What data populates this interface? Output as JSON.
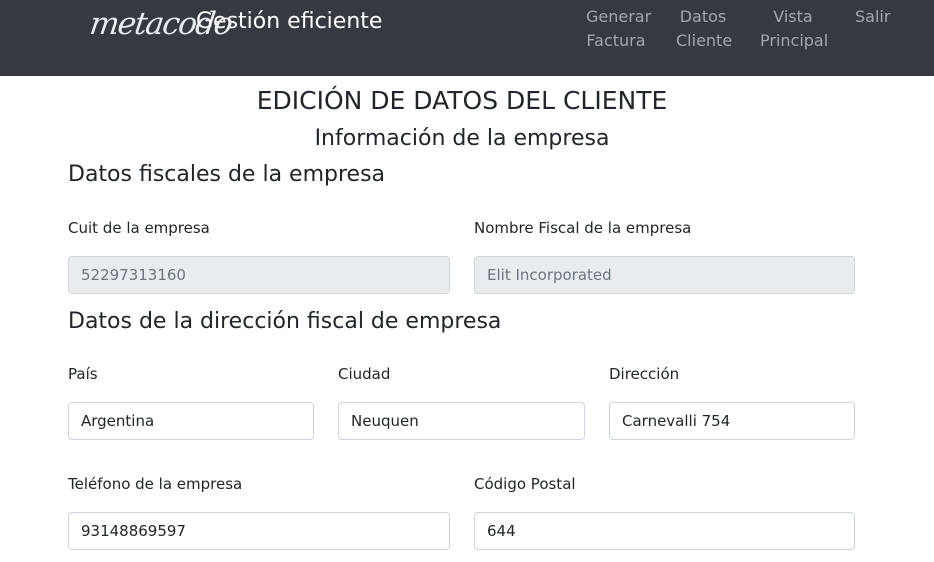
{
  "navbar": {
    "logo_text": "metacodo",
    "brand": "Gestión eficiente",
    "links": [
      {
        "line1": "Generar",
        "line2": "Factura"
      },
      {
        "line1": "Datos",
        "line2": "Cliente"
      },
      {
        "line1": "Vista",
        "line2": "Principal"
      },
      {
        "line1": "Salir",
        "line2": ""
      }
    ],
    "background_color": "#343a40"
  },
  "page": {
    "title": "EDICIÓN DE DATOS DEL CLIENTE",
    "subtitle": "Información de la empresa"
  },
  "fiscal": {
    "section_title": "Datos fiscales de la empresa",
    "cuit": {
      "label": "Cuit de la empresa",
      "value": "52297313160"
    },
    "nombre_fiscal": {
      "label": "Nombre Fiscal de la empresa",
      "value": "Elit Incorporated"
    }
  },
  "direccion": {
    "section_title": "Datos de la dirección fiscal de empresa",
    "pais": {
      "label": "País",
      "value": "Argentina"
    },
    "ciudad": {
      "label": "Ciudad",
      "value": "Neuquen"
    },
    "direccion": {
      "label": "Dirección",
      "value": "Carnevalli 754"
    },
    "telefono": {
      "label": "Teléfono de la empresa",
      "value": "93148869597"
    },
    "codigo_postal": {
      "label": "Código Postal",
      "value": "644"
    }
  }
}
